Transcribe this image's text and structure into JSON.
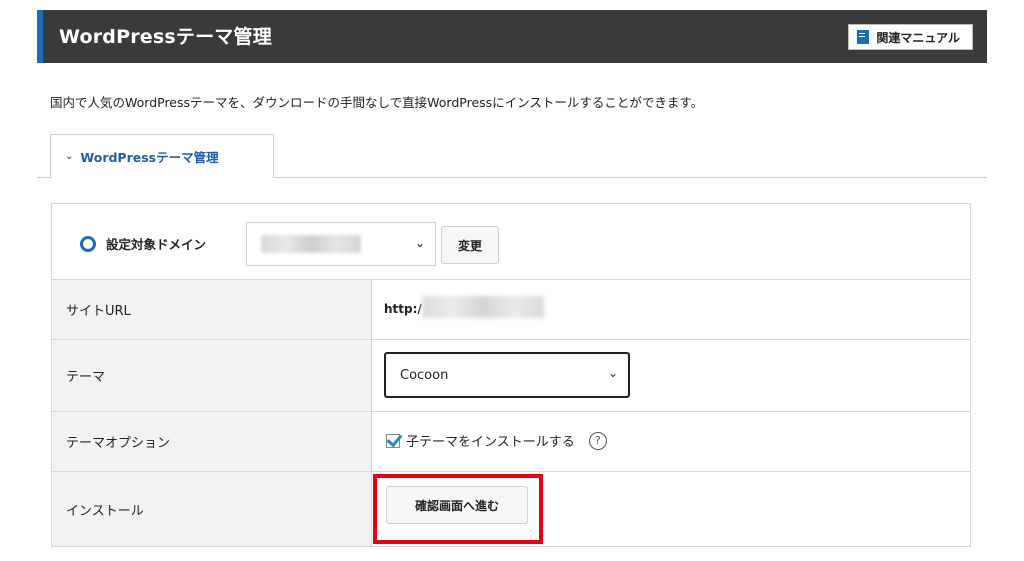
{
  "header": {
    "title": "WordPressテーマ管理",
    "manual_label": "関連マニュアル",
    "accent_color": "#1e6bb8",
    "background_color": "#3a3a3a"
  },
  "description": "国内で人気のWordPressテーマを、ダウンロードの手間なしで直接WordPressにインストールすることができます。",
  "tab": {
    "label": "WordPressテーマ管理"
  },
  "domain": {
    "label": "設定対象ドメイン",
    "change_label": "変更"
  },
  "rows": [
    {
      "label": "サイトURL",
      "value": "http:/"
    },
    {
      "label": "テーマ",
      "value": "Cocoon"
    },
    {
      "label": "テーマオプション",
      "value": "子テーマをインストールする",
      "checked": true
    },
    {
      "label": "インストール",
      "button_label": "確認画面へ進む"
    }
  ],
  "highlight_color": "#e60012"
}
